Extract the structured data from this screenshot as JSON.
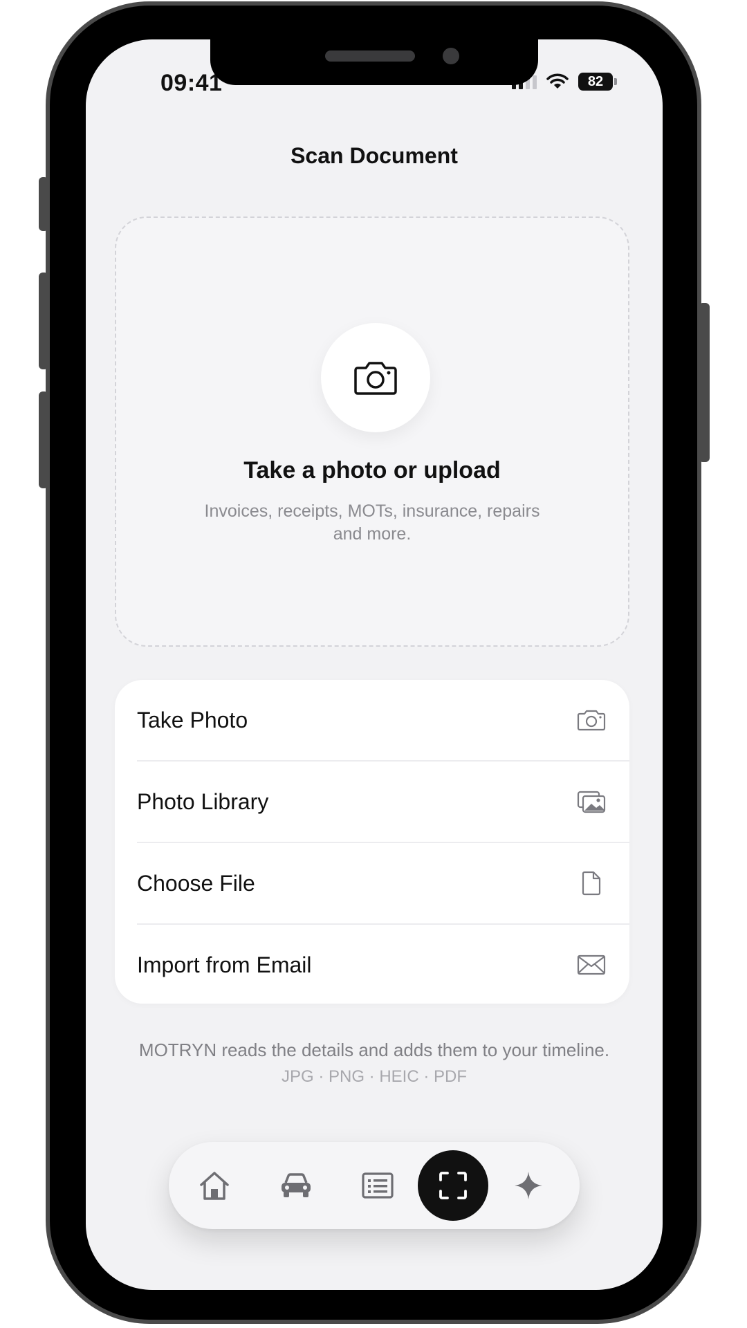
{
  "status_bar": {
    "time": "09:41",
    "battery": "82"
  },
  "header": {
    "title": "Scan Document"
  },
  "drop_zone": {
    "icon": "camera-icon",
    "title": "Take a photo or upload",
    "description": "Invoices, receipts, MOTs, insurance, repairs and more."
  },
  "options": [
    {
      "label": "Take Photo",
      "icon": "camera-icon"
    },
    {
      "label": "Photo Library",
      "icon": "photo-library-icon"
    },
    {
      "label": "Choose File",
      "icon": "file-icon"
    },
    {
      "label": "Import from Email",
      "icon": "envelope-icon"
    }
  ],
  "footer": {
    "note": "MOTRYN reads the details and adds them to your timeline.",
    "formats": "JPG · PNG · HEIC · PDF"
  },
  "tab_bar": {
    "tabs": [
      {
        "icon": "home-icon",
        "active": false
      },
      {
        "icon": "car-icon",
        "active": false
      },
      {
        "icon": "list-icon",
        "active": false
      },
      {
        "icon": "scan-icon",
        "active": true
      },
      {
        "icon": "sparkle-icon",
        "active": false
      }
    ]
  },
  "colors": {
    "background": "#f2f2f4",
    "card": "#ffffff",
    "accent": "#111111",
    "muted_text": "#8a8a8f"
  }
}
